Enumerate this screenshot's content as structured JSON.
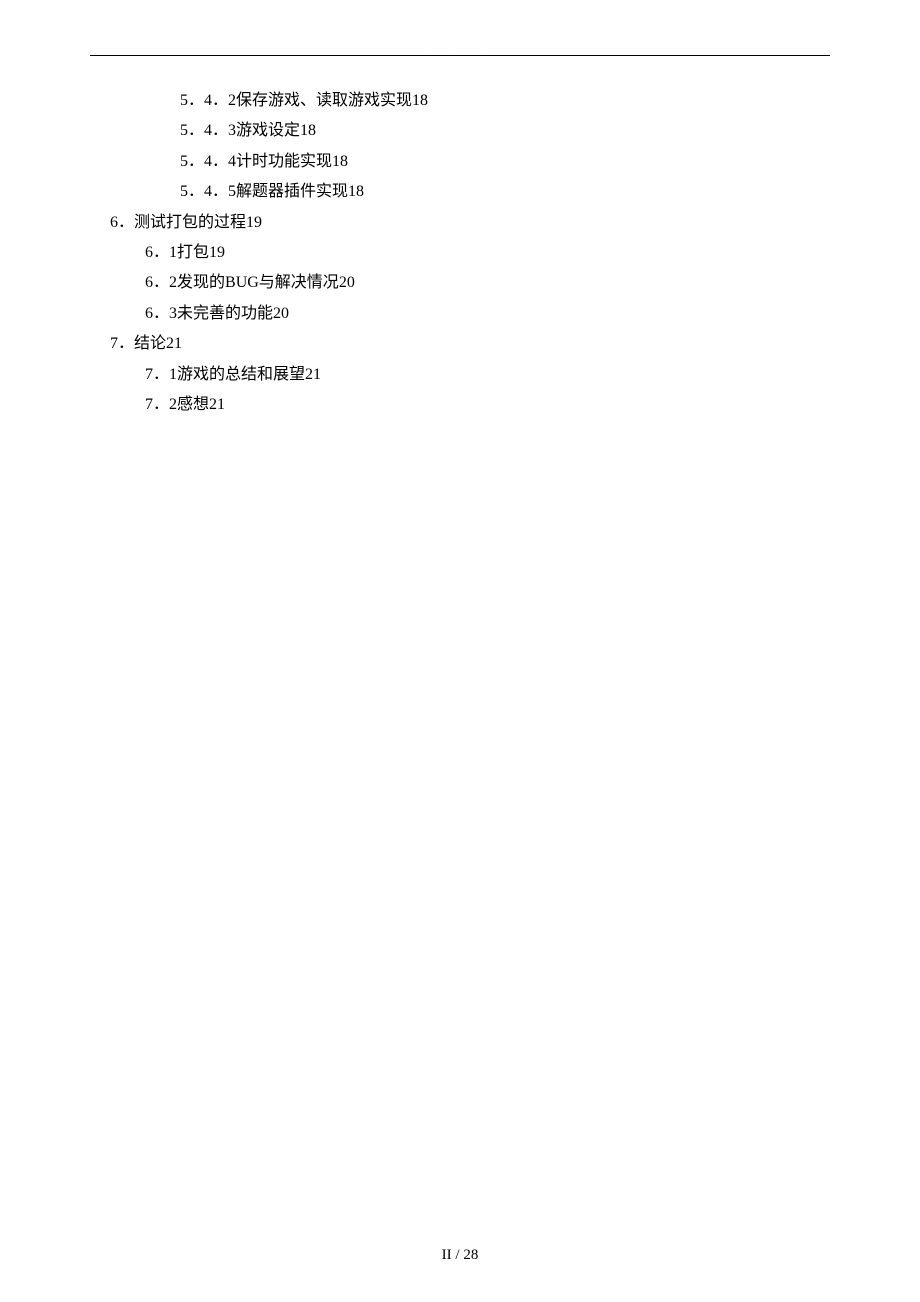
{
  "header": {
    "dots": ".    .        ."
  },
  "toc": [
    {
      "indent": 2,
      "num": "5．4．2",
      "title": "保存游戏、读取游戏实现",
      "page": "18"
    },
    {
      "indent": 2,
      "num": "5．4．3",
      "title": "游戏设定",
      "page": "18"
    },
    {
      "indent": 2,
      "num": "5．4．4",
      "title": "计时功能实现",
      "page": "18"
    },
    {
      "indent": 2,
      "num": "5．4．5",
      "title": "解题器插件实现",
      "page": "18"
    },
    {
      "indent": 0,
      "num": "6．",
      "title": "测试打包的过程",
      "page": "19"
    },
    {
      "indent": 1,
      "num": "6．1",
      "title": "打包",
      "page": "19"
    },
    {
      "indent": 1,
      "num": "6．2",
      "title": "发现的BUG与解决情况",
      "page": "20"
    },
    {
      "indent": 1,
      "num": "6．3",
      "title": "未完善的功能",
      "page": "20"
    },
    {
      "indent": 0,
      "num": "7．",
      "title": "结论",
      "page": "21"
    },
    {
      "indent": 1,
      "num": "7．1",
      "title": "游戏的总结和展望",
      "page": "21"
    },
    {
      "indent": 1,
      "num": "7．2",
      "title": "感想",
      "page": "21"
    }
  ],
  "footer": {
    "page_label": "II / 28"
  }
}
